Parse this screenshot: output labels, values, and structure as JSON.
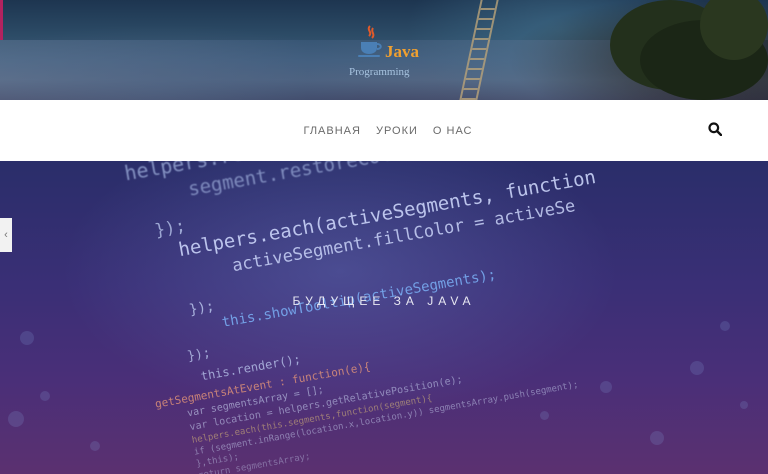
{
  "logo": {
    "java_text": "Java",
    "subtitle": "Programming"
  },
  "nav": {
    "items": [
      {
        "label": "ГЛАВНАЯ"
      },
      {
        "label": "УРОКИ"
      },
      {
        "label": "О НАС"
      }
    ],
    "search_icon": "search-icon"
  },
  "hero": {
    "title": "БУДУЩЕЕ ЗА JAVA",
    "slider_prev_icon": "chevron-left-icon",
    "code_lines": [
      "helpers.reset",
      "segment.restoreColor",
      "});",
      "helpers.each(activeSegments, function",
      "activeSegment.fillColor = activeSe",
      "});",
      "this.showTooltip(activeSegments);",
      "});",
      "this.render();",
      "getSegmentsAtEvent : function(e){",
      "var segmentsArray = [];",
      "var location = helpers.getRelativePosition(e);",
      "helpers.each(this.segments,function(segment){",
      "if (segment.inRange(location.x,location.y)) segmentsArray.push(segment);",
      "},this);",
      "return segmentsArray;"
    ]
  },
  "colors": {
    "nav_text": "#6a6a6a",
    "accent": "#b2225f",
    "logo_java": "#f0a030",
    "logo_subtitle": "#a8c4e0",
    "hero_top": "#2a2e6a",
    "hero_bottom": "#5b3070"
  }
}
